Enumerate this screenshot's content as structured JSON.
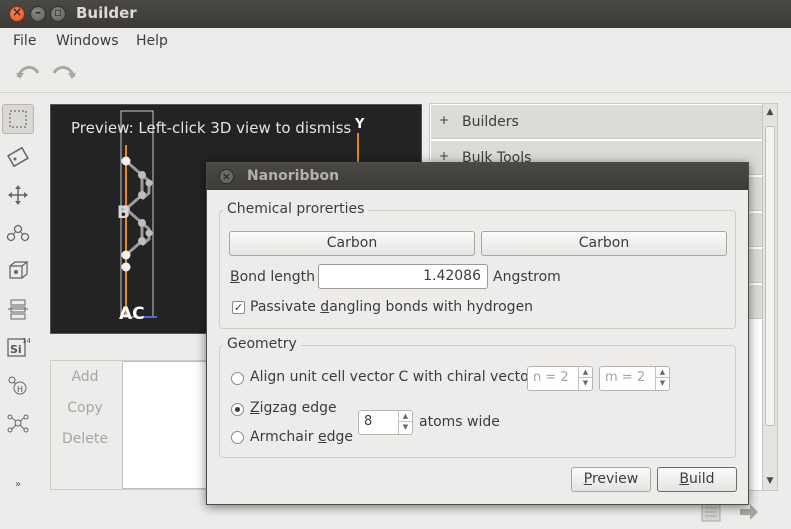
{
  "window": {
    "title": "Builder"
  },
  "menu": {
    "file": "File",
    "windows": "Windows",
    "help": "Help"
  },
  "preview": {
    "message": "Preview: Left-click 3D view to dismiss",
    "axis_label": "Y",
    "atom_label_b": "B",
    "direction_label": "AC"
  },
  "list_buttons": {
    "add": "Add",
    "copy": "Copy",
    "delete": "Delete"
  },
  "right_panel": {
    "rows": [
      {
        "label": "Builders"
      },
      {
        "label": "Bulk Tools"
      }
    ]
  },
  "dialog": {
    "title": "Nanoribbon",
    "chemical": {
      "frame_title": "Chemical prorerties",
      "element_a": "Carbon",
      "element_b": "Carbon",
      "bond_length_label": "Bond length",
      "bond_length_value": "1.42086",
      "bond_length_unit": "Angstrom",
      "passivate_label": "Passivate dangling bonds with hydrogen",
      "passivate_checked": true
    },
    "geometry": {
      "frame_title": "Geometry",
      "align_label": "Align unit cell vector C with chiral vector",
      "n_value": "n = 2",
      "m_value": "m = 2",
      "zigzag_label": "Zigzag edge",
      "armchair_label": "Armchair edge",
      "width_value": "8",
      "width_unit": "atoms wide",
      "selected_edge": "zigzag"
    },
    "buttons": {
      "preview": "Preview",
      "build": "Build"
    }
  },
  "icons": [
    "undo-icon",
    "redo-icon",
    "select-icon",
    "tag-icon",
    "move-icon",
    "bond-icon",
    "crystal-icon",
    "hierarchy-icon",
    "si-element-icon",
    "hydrogen-icon",
    "network-icon",
    "more-icon",
    "document-icon",
    "arrow-right-icon"
  ],
  "colors": {
    "titlebar": "#3c3b37",
    "preview_bg": "#232323",
    "orange_axis": "#e8871a"
  }
}
